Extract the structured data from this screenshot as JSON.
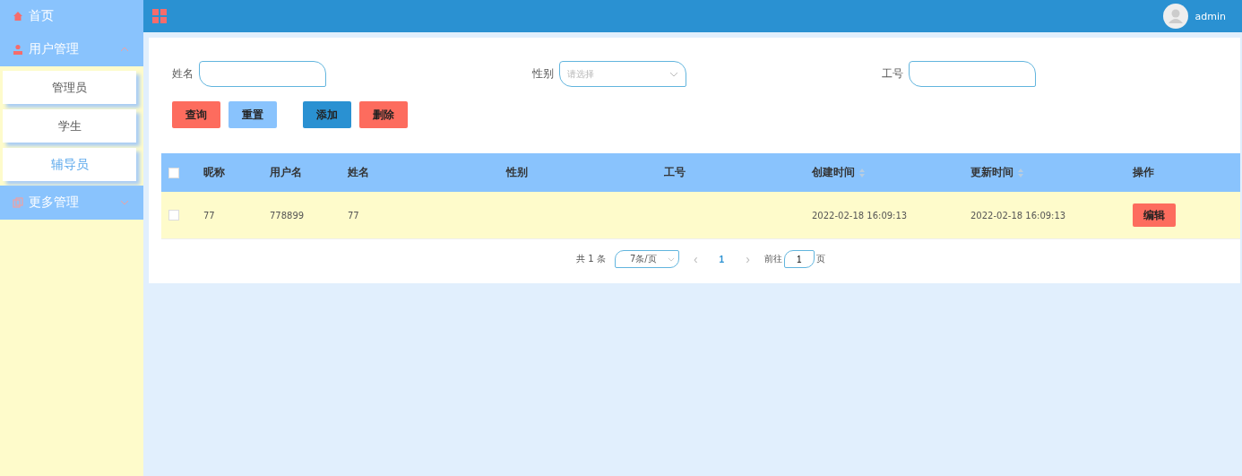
{
  "sidebar": {
    "items": [
      {
        "label": "首页",
        "kind": "link"
      },
      {
        "label": "用户管理",
        "kind": "group",
        "expanded": true,
        "children": [
          {
            "label": "管理员",
            "selected": false
          },
          {
            "label": "学生",
            "selected": false
          },
          {
            "label": "辅导员",
            "selected": true
          }
        ]
      },
      {
        "label": "更多管理",
        "kind": "group",
        "expanded": false
      }
    ]
  },
  "header": {
    "user": "admin"
  },
  "filters": [
    {
      "label": "姓名",
      "kind": "input"
    },
    {
      "label": "性别",
      "kind": "select",
      "placeholder": "请选择"
    },
    {
      "label": "工号",
      "kind": "input"
    }
  ],
  "actions": [
    {
      "label": "查询",
      "kind": "danger"
    },
    {
      "label": "重置",
      "kind": "light"
    },
    {
      "label": "添加",
      "kind": "primary"
    },
    {
      "label": "删除",
      "kind": "danger"
    }
  ],
  "table": {
    "select_all": false,
    "columns": [
      {
        "label": "昵称",
        "sortable": false
      },
      {
        "label": "用户名",
        "sortable": false
      },
      {
        "label": "姓名",
        "sortable": false
      },
      {
        "label": "性别",
        "sortable": false
      },
      {
        "label": "工号",
        "sortable": false
      },
      {
        "label": "创建时间",
        "sortable": true
      },
      {
        "label": "更新时间",
        "sortable": true
      },
      {
        "label": "操作",
        "sortable": false
      }
    ],
    "rows": [
      {
        "checked": false,
        "cells": [
          "77",
          "778899",
          "77",
          "",
          "",
          "2022-02-18 16:09:13",
          "2022-02-18 16:09:13"
        ],
        "action": "编辑"
      }
    ]
  },
  "pagination": {
    "total": "共 1 条",
    "page_size": "7条/页",
    "prev": "‹",
    "pages": [
      {
        "label": "1",
        "selected": true
      }
    ],
    "next": "›",
    "goto_label": "前往",
    "goto_value": "1",
    "goto_suffix": "页"
  }
}
